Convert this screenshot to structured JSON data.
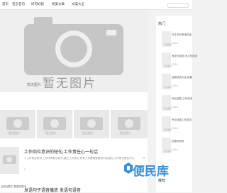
{
  "nav": {
    "items": [
      "首页",
      "名言名句",
      "好句好段",
      "优美文章",
      "文案大全"
    ]
  },
  "hero": {
    "caption": "暂无图片",
    "placeholder": "暂无图片"
  },
  "thumbs": [
    "暂无图片",
    "暂无图片",
    "暂无图片",
    "暂无图片"
  ],
  "article": {
    "title": "工作岗位意识的短句,工作责任心一句话",
    "text": "1.工作岗位意识,工作中有职业意识,建立工作意识,所有工作都是按照意识实施的,工作意识是否可以",
    "meta": "0",
    "views": "76"
  },
  "sidebar": {
    "heading": "热门",
    "items": [
      {
        "title": "学生学好老师的话",
        "date": "2024-",
        "thumb": "暂无图片"
      },
      {
        "title": "有关的说说,写人的说说",
        "date": "2024-",
        "thumb": "暂无图片"
      },
      {
        "title": "经典说说大全,经典",
        "date": "2024-",
        "thumb": "暂无图片"
      },
      {
        "title": "专业技能,工作说说",
        "date": "2024-",
        "thumb": "暂无图片"
      },
      {
        "title": "专业技能工作说说",
        "date": "2024-",
        "thumb": "暂无图片"
      },
      {
        "title": "全面的说说",
        "date": "2024-",
        "thumb": "暂无图片"
      }
    ],
    "footer": "推荐"
  },
  "bottom": {
    "line": "当前加载中,数据加载中",
    "title": "发语句子语音播放 发语句语音"
  },
  "badge": "便民库",
  "colors": {
    "accent": "#3a8fd6"
  }
}
